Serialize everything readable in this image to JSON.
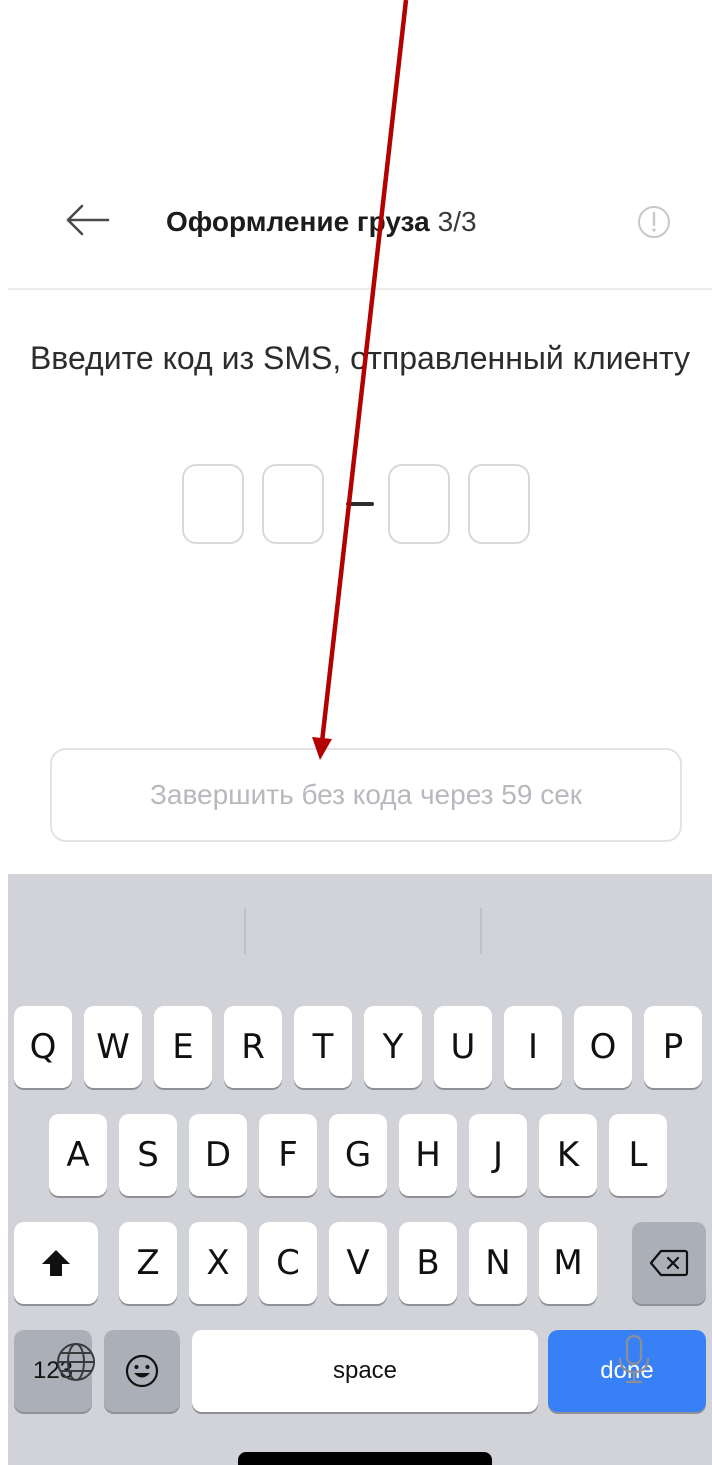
{
  "header": {
    "title": "Оформление груза",
    "step": "3/3",
    "back_icon": "arrow-left-icon",
    "info_icon": "info-circle-icon"
  },
  "main": {
    "prompt": "Введите код из SMS, отправленный клиенту",
    "code_digits": [
      "",
      "",
      "",
      ""
    ],
    "code_separator": "–",
    "skip_button": "Завершить без кода через 59 сек"
  },
  "keyboard": {
    "row1": [
      "Q",
      "W",
      "E",
      "R",
      "T",
      "Y",
      "U",
      "I",
      "O",
      "P"
    ],
    "row2": [
      "A",
      "S",
      "D",
      "F",
      "G",
      "H",
      "J",
      "K",
      "L"
    ],
    "row3": [
      "Z",
      "X",
      "C",
      "V",
      "B",
      "N",
      "M"
    ],
    "numbers_key": "123",
    "space_key": "space",
    "done_key": "done",
    "shift_icon": "shift-icon",
    "backspace_icon": "backspace-icon",
    "emoji_icon": "emoji-icon",
    "globe_icon": "globe-icon",
    "mic_icon": "microphone-icon"
  },
  "colors": {
    "done_key": "#3880f6",
    "keyboard_bg": "#d1d3d9",
    "annotation_arrow": "#b30000"
  }
}
